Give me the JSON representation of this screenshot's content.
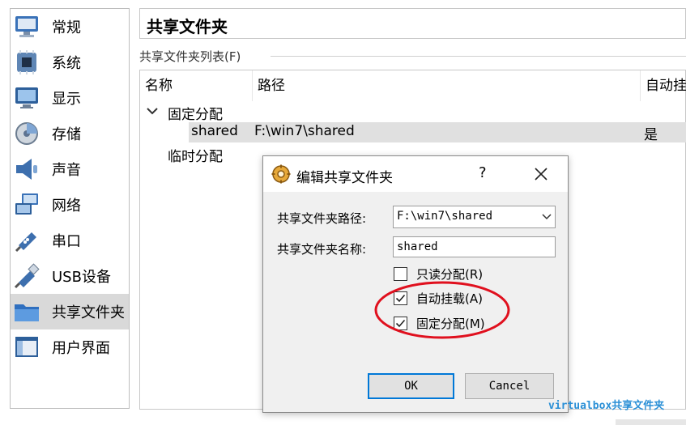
{
  "sidebar": {
    "items": [
      {
        "label": "常规",
        "icon": "general-icon"
      },
      {
        "label": "系统",
        "icon": "system-icon"
      },
      {
        "label": "显示",
        "icon": "display-icon"
      },
      {
        "label": "存储",
        "icon": "storage-icon"
      },
      {
        "label": "声音",
        "icon": "audio-icon"
      },
      {
        "label": "网络",
        "icon": "network-icon"
      },
      {
        "label": "串口",
        "icon": "serial-port-icon"
      },
      {
        "label": "USB设备",
        "icon": "usb-icon"
      },
      {
        "label": "共享文件夹",
        "icon": "shared-folder-icon"
      },
      {
        "label": "用户界面",
        "icon": "user-interface-icon"
      }
    ],
    "active_index": 8
  },
  "main": {
    "title": "共享文件夹",
    "list_label": "共享文件夹列表(F)",
    "table": {
      "headers": [
        "名称",
        "路径",
        "自动挂"
      ],
      "groups": [
        {
          "label": "固定分配",
          "expanded": true
        },
        {
          "label": "临时分配"
        }
      ],
      "rows": [
        {
          "name": "shared",
          "path": "F:\\win7\\shared",
          "auto": "是"
        }
      ]
    }
  },
  "dialog": {
    "title": "编辑共享文件夹",
    "help": "?",
    "path_label": "共享文件夹路径:",
    "path_value": "F:\\win7\\shared",
    "name_label": "共享文件夹名称:",
    "name_value": "shared",
    "checkboxes": [
      {
        "label": "只读分配(R)",
        "checked": false
      },
      {
        "label": "自动挂载(A)",
        "checked": true
      },
      {
        "label": "固定分配(M)",
        "checked": true
      }
    ],
    "ok_label": "OK",
    "cancel_label": "Cancel"
  },
  "watermark": "virtualbox共享文件夹",
  "colors": {
    "annotation": "#e0101e",
    "watermark": "#2a8fd6",
    "selection": "#e0e0e0",
    "dialog_bg": "#f0f0f0",
    "default_button_border": "#0078d7"
  }
}
